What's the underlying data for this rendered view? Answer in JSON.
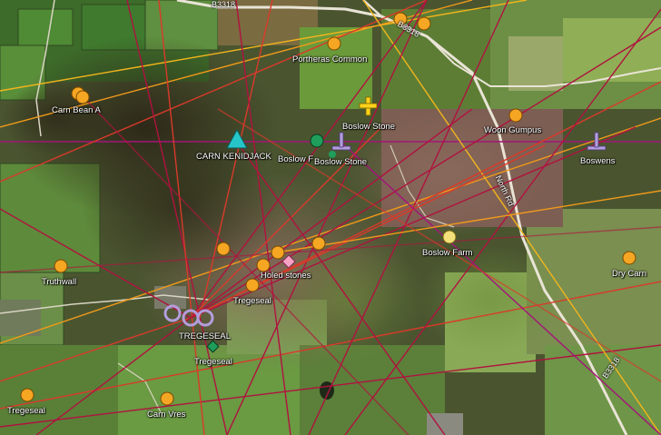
{
  "map": {
    "colors": {
      "ley_crimson": "#b0123f",
      "ley_red": "#d93a2a",
      "ley_orange": "#f09a1a",
      "ley_gold": "#f2b51c",
      "ley_magenta": "#a3147a",
      "marker_orange": "#f5a623",
      "marker_lavender": "#b39ddb",
      "marker_cyan": "#26c6c8",
      "marker_green": "#1e9e5a",
      "marker_yellow_cross": "#ffd21a",
      "marker_pink": "#f7a1c4",
      "light_yellow": "#f3e07a"
    },
    "roads": {
      "b3318_top": "B3318",
      "b3318_north": "B3318",
      "b3318_bottom": "B3318",
      "north_rd": "North Rd"
    },
    "labels": {
      "portheras_common": "Portheras Common",
      "carn_bean_a": "Carn Bean A",
      "boslow_stone_cross": "Boslow Stone",
      "woon_gumpus": "Woon Gumpus",
      "carn_kenidjack": "CARN KENIDJACK",
      "boslow_f": "Boslow F",
      "boslow_stone": "Boslow Stone",
      "boswens": "Boswens",
      "boslow_farm": "Boslow Farm",
      "truthwall": "Truthwall",
      "holed_stones": "Holed stones",
      "dry_carn": "Dry Carn",
      "tregeseal_small": "Tregeseal",
      "tregeseal_caps": "TREGESEAL",
      "tregeseal_green": "Tregeseal",
      "tregeseal_left": "Tregeseal",
      "carn_vres": "Carn Vres"
    },
    "icons": {
      "site_circle": "orange-circle-marker-icon",
      "standing_stone": "standing-stone-marker-icon",
      "stone_circle": "stone-circle-marker-icon",
      "cairn": "cairn-triangle-marker-icon",
      "cross": "cross-marker-icon",
      "holed_stone": "holed-stone-diamond-icon",
      "settlement": "green-diamond-marker-icon"
    }
  }
}
